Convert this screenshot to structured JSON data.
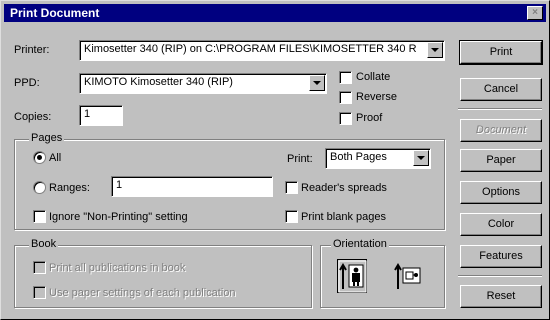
{
  "window": {
    "title": "Print Document",
    "close_glyph": "×"
  },
  "printer": {
    "label": "Printer:",
    "value": "Kimosetter 340 (RIP) on C:\\PROGRAM FILES\\KIMOSETTER 340 R"
  },
  "ppd": {
    "label": "PPD:",
    "value": "KIMOTO Kimosetter 340 (RIP)"
  },
  "copies": {
    "label": "Copies:",
    "value": "1"
  },
  "options": {
    "collate": "Collate",
    "reverse": "Reverse",
    "proof": "Proof"
  },
  "pages": {
    "group_label": "Pages",
    "all_label": "All",
    "ranges_label": "Ranges:",
    "ranges_value": "1",
    "ignore_label": "Ignore \"Non-Printing\" setting",
    "print_label": "Print:",
    "print_value": "Both Pages",
    "readers_label": "Reader's spreads",
    "blank_label": "Print blank pages"
  },
  "book": {
    "group_label": "Book",
    "print_all": "Print all publications in book",
    "use_paper": "Use paper settings of each publication"
  },
  "orientation": {
    "group_label": "Orientation"
  },
  "buttons": {
    "print": "Print",
    "cancel": "Cancel",
    "document": "Document",
    "paper": "Paper",
    "options": "Options",
    "color": "Color",
    "features": "Features",
    "reset": "Reset"
  }
}
